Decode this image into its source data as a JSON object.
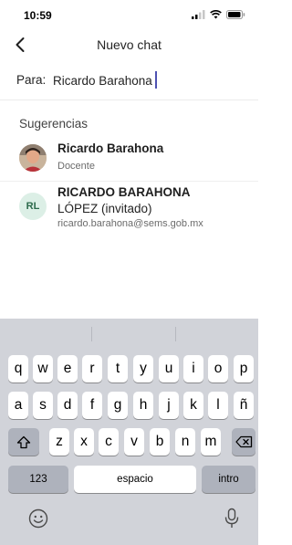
{
  "status_bar": {
    "time": "10:59",
    "icons": [
      "signal-icon",
      "wifi-icon",
      "battery-icon"
    ]
  },
  "nav": {
    "title": "Nuevo chat",
    "back_icon": "chevron-left-icon"
  },
  "to_field": {
    "label": "Para:",
    "value": "Ricardo Barahona"
  },
  "suggestions": {
    "header": "Sugerencias",
    "items": [
      {
        "name": "Ricardo Barahona",
        "role": "Docente",
        "avatar": "photo"
      },
      {
        "initials": "RL",
        "name_line1": "RICARDO BARAHONA",
        "name_line2": "LÓPEZ (invitado)",
        "email": "ricardo.barahona@sems.gob.mx"
      }
    ]
  },
  "keyboard": {
    "row1": [
      "q",
      "w",
      "e",
      "r",
      "t",
      "y",
      "u",
      "i",
      "o",
      "p"
    ],
    "row2": [
      "a",
      "s",
      "d",
      "f",
      "g",
      "h",
      "j",
      "k",
      "l",
      "ñ"
    ],
    "row3": [
      "z",
      "x",
      "c",
      "v",
      "b",
      "n",
      "m"
    ],
    "numbers_key": "123",
    "space_key": "espacio",
    "return_key": "intro",
    "shift_icon": "shift-icon",
    "delete_icon": "backspace-icon",
    "emoji_icon": "emoji-icon",
    "mic_icon": "microphone-icon"
  },
  "colors": {
    "accent": "#4f52b2",
    "keyboard_bg": "#d1d3d9",
    "key_bg": "#ffffff",
    "key_dark": "#aeb2bc"
  }
}
